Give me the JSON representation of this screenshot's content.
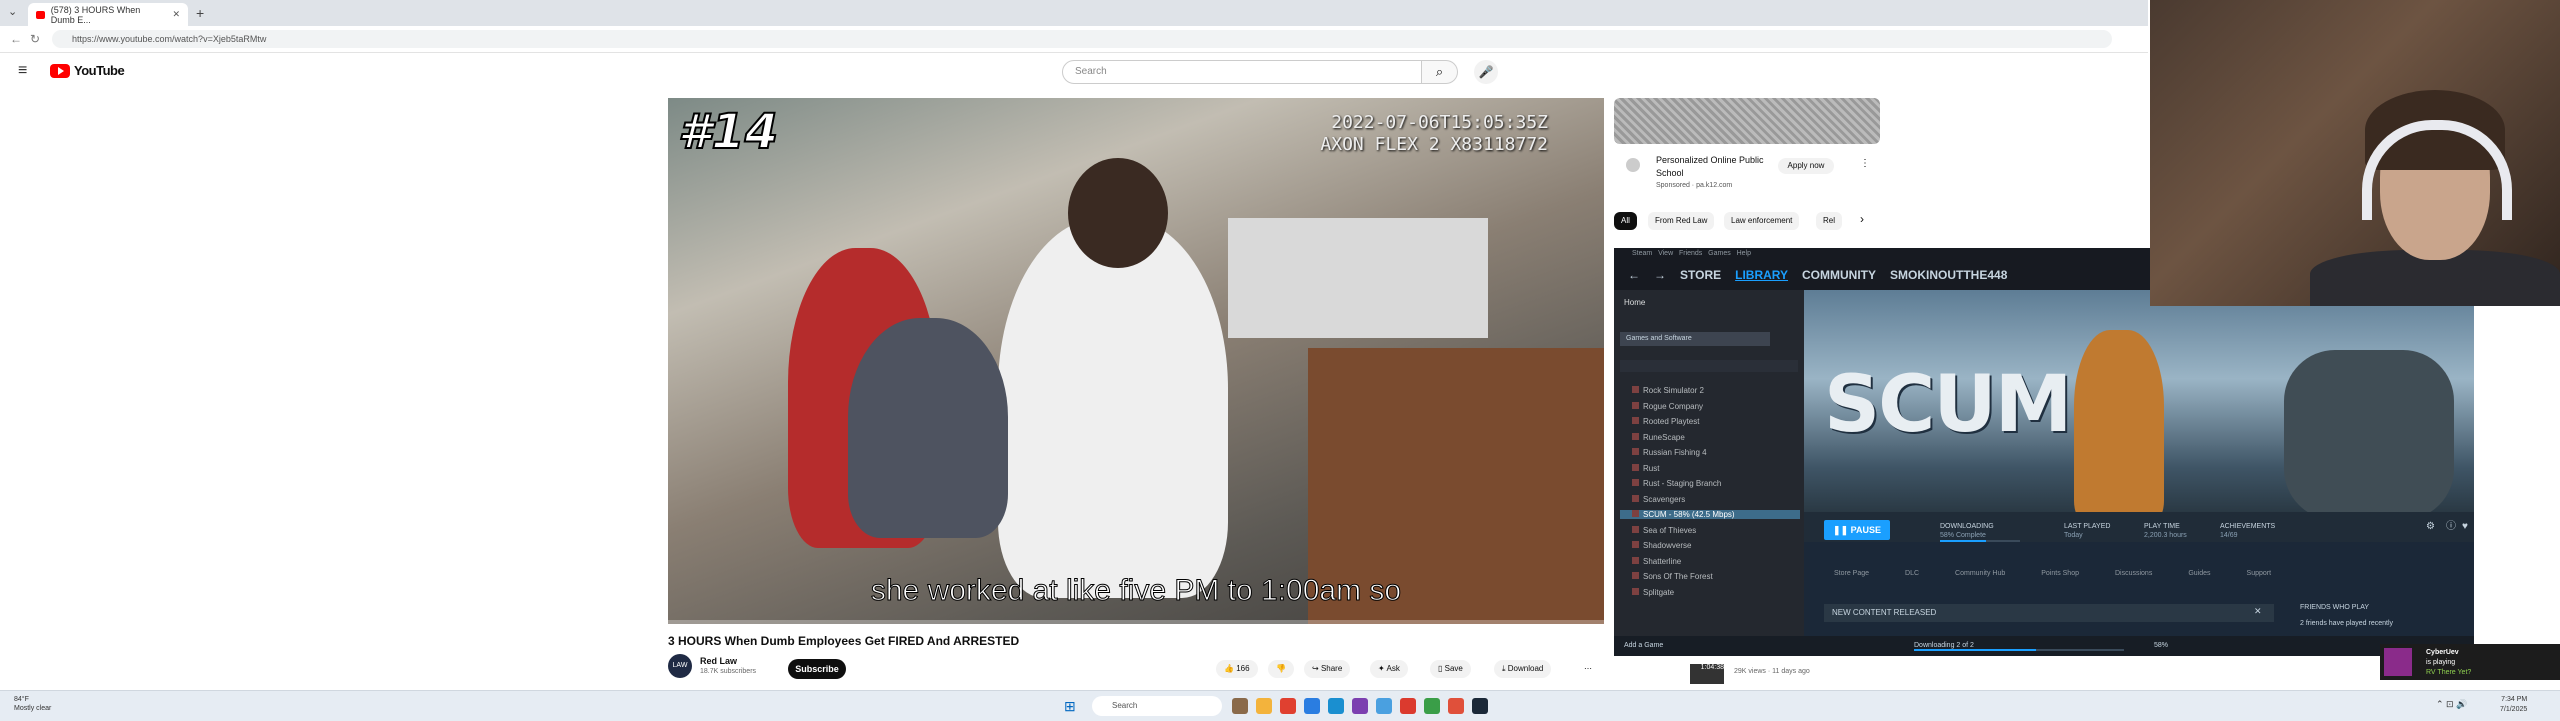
{
  "browser": {
    "tab_title": "(578) 3 HOURS When Dumb E...",
    "url": "https://www.youtube.com/watch?v=Xjeb5taRMtw",
    "new_tab": "+"
  },
  "youtube": {
    "logo_text": "YouTube",
    "search_placeholder": "Search"
  },
  "video": {
    "number_overlay": "#14",
    "timestamp_line1": "2022-07-06T15:05:35Z",
    "timestamp_line2": "AXON FLEX 2 X83118772",
    "caption": "she worked at like five PM to 1:00am so",
    "progress": 0.0,
    "title": "3 HOURS When Dumb Employees Get FIRED And ARRESTED",
    "channel_name": "Red Law",
    "channel_avatar": "LAW",
    "subscribers": "18.7K subscribers",
    "subscribe_label": "Subscribe",
    "like_count": "166",
    "share_label": "Share",
    "ask_label": "Ask",
    "save_label": "Save",
    "download_label": "Download"
  },
  "sidebar": {
    "ad_title": "Personalized Online Public School",
    "ad_sponsor": "Sponsored · pa.k12.com",
    "ad_button": "Apply now",
    "chips": [
      "All",
      "From Red Law",
      "Law enforcement",
      "Rel"
    ],
    "below_text": "29K views · 11 days ago",
    "thumb_duration": "1:04:38"
  },
  "steam": {
    "menu": [
      "Steam",
      "View",
      "Friends",
      "Games",
      "Help"
    ],
    "nav": [
      "STORE",
      "LIBRARY",
      "COMMUNITY",
      "SMOKINOUTTHE448"
    ],
    "home": "Home",
    "filter": "Games and Software",
    "games": [
      "Rock Simulator 2",
      "Rogue Company",
      "Rooted Playtest",
      "RuneScape",
      "Russian Fishing 4",
      "Rust",
      "Rust - Staging Branch",
      "Scavengers",
      "SCUM - 58% (42.5 Mbps)",
      "Sea of Thieves",
      "Shadowverse",
      "Shatterline",
      "Sons Of The Forest",
      "Splitgate"
    ],
    "selected_index": 8,
    "hero_logo": "SCUM",
    "pause_label": "PAUSE",
    "downloading_label": "DOWNLOADING",
    "downloading_sub": "58% Complete",
    "download_progress": 0.58,
    "last_played_label": "LAST PLAYED",
    "last_played_value": "Today",
    "play_time_label": "PLAY TIME",
    "play_time_value": "2,200.3 hours",
    "achievements_label": "ACHIEVEMENTS",
    "achievements_value": "14/69",
    "tabs": [
      "Store Page",
      "DLC",
      "Community Hub",
      "Points Shop",
      "Discussions",
      "Guides",
      "Support"
    ],
    "new_content": "NEW CONTENT RELEASED",
    "friends_header": "FRIENDS WHO PLAY",
    "friends_text": "2 friends have played recently",
    "add_game": "Add a Game",
    "bottom_dl": "Downloading 2 of 2",
    "bottom_pct": "58%"
  },
  "notification": {
    "name": "CyberUev",
    "line2": "is playing",
    "line3": "RV There Yet?"
  },
  "taskbar": {
    "temp": "84°F",
    "weather": "Mostly clear",
    "search": "Search",
    "time": "7:34 PM",
    "date": "7/1/2025"
  }
}
